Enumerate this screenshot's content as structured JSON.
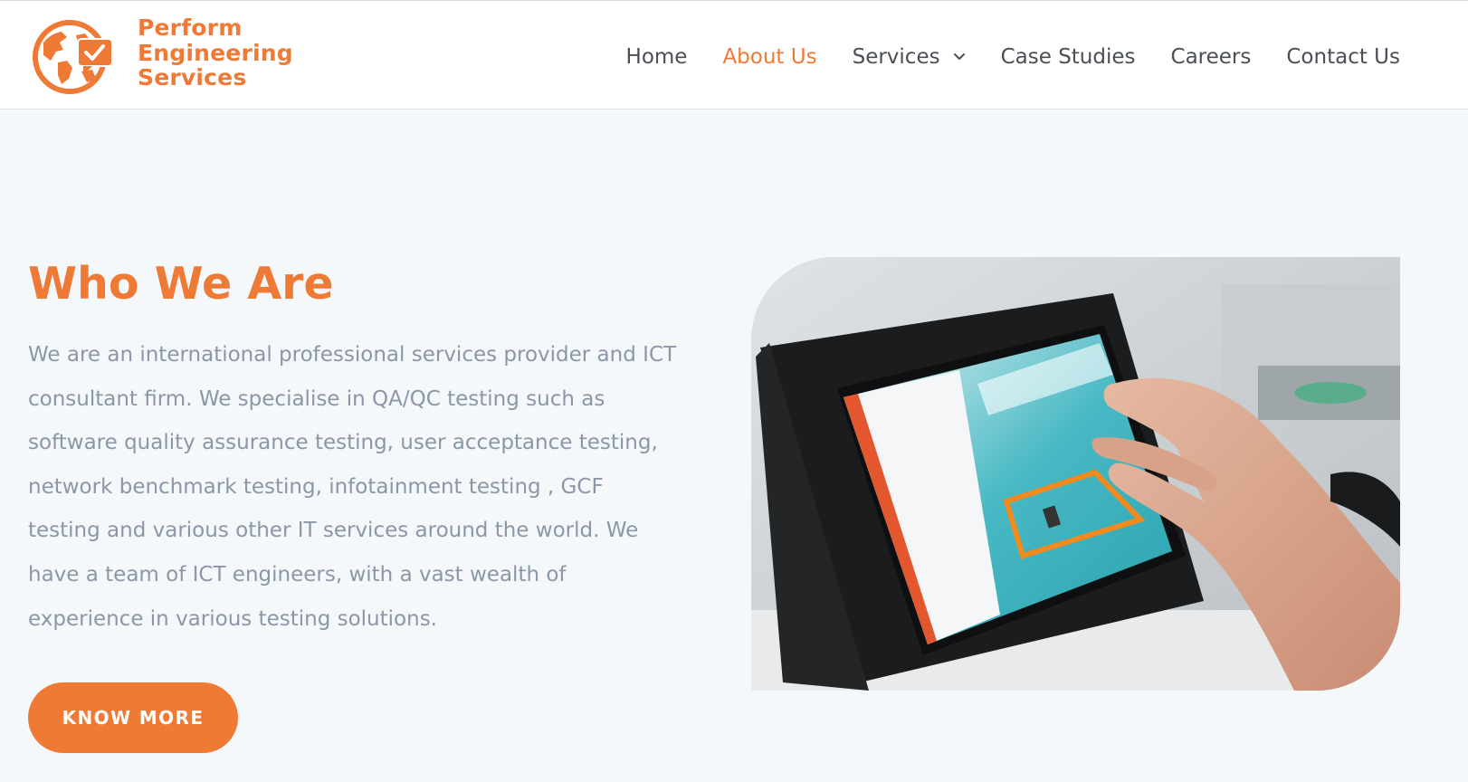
{
  "brand": {
    "name_line1": "Perform",
    "name_line2": "Engineering",
    "name_line3": "Services",
    "logo_icon": "globe-checkmark-icon",
    "accent_color": "#ef7a36"
  },
  "nav": {
    "items": [
      {
        "label": "Home",
        "active": false
      },
      {
        "label": "About Us",
        "active": true
      },
      {
        "label": "Services",
        "active": false,
        "has_dropdown": true
      },
      {
        "label": "Case Studies",
        "active": false
      },
      {
        "label": "Careers",
        "active": false
      },
      {
        "label": "Contact Us",
        "active": false
      }
    ],
    "dropdown_icon": "chevron-down-icon"
  },
  "hero": {
    "title": "Who We Are",
    "body": "We are an international professional services provider and ICT consultant firm. We specialise in QA/QC testing such as software quality assurance testing, user acceptance testing, network benchmark testing, infotainment testing , GCF testing and various other IT services around the world. We have a team of ICT engineers, with a vast wealth of experience in various testing solutions.",
    "cta_label": "KNOW MORE",
    "image_subject": "hand-touching-tablet-photo"
  },
  "colors": {
    "page_background": "#f5f8fb",
    "header_background": "#ffffff",
    "body_text": "#8b97a6",
    "nav_text": "#4a4f55"
  }
}
